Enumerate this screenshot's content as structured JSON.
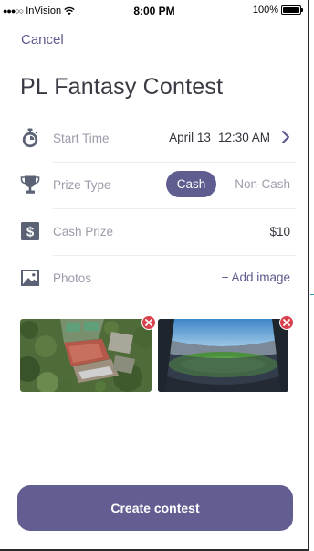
{
  "status_bar": {
    "signal_dots": "●●●○○",
    "carrier": "InVision",
    "time": "8:00 PM",
    "battery_percent": "100%",
    "icons": [
      "wifi-icon",
      "battery-icon"
    ]
  },
  "header": {
    "cancel_label": "Cancel",
    "title": "PL Fantasy Contest"
  },
  "form": {
    "start_time": {
      "label": "Start Time",
      "date": "April 13",
      "time": "12:30 AM",
      "icon": "stopwatch-icon"
    },
    "prize_type": {
      "label": "Prize Type",
      "options": [
        "Cash",
        "Non-Cash"
      ],
      "selected": "Cash",
      "icon": "trophy-icon"
    },
    "cash_prize": {
      "label": "Cash Prize",
      "value": "$10",
      "icon": "dollar-icon"
    },
    "photos": {
      "label": "Photos",
      "add_label": "+ Add image",
      "icon": "image-icon",
      "count": 2
    }
  },
  "footer": {
    "create_label": "Create contest"
  },
  "colors": {
    "accent": "#5f5c8f",
    "label_gray": "#9c9cab",
    "remove_red": "#d8414d",
    "icon_slate": "#5b6276"
  }
}
